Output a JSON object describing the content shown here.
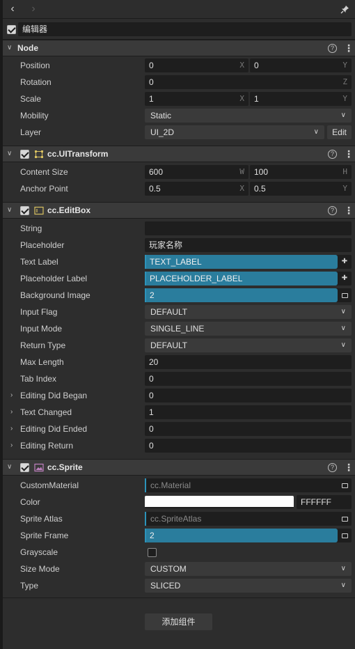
{
  "toolbar": {
    "back_icon": "chevron-left",
    "forward_icon": "chevron-right",
    "pin_icon": "pin"
  },
  "node_name": "编辑器",
  "sections": {
    "node": {
      "title": "Node",
      "position": {
        "label": "Position",
        "x": "0",
        "y": "0"
      },
      "rotation": {
        "label": "Rotation",
        "z": "0"
      },
      "scale": {
        "label": "Scale",
        "x": "1",
        "y": "1"
      },
      "mobility": {
        "label": "Mobility",
        "value": "Static"
      },
      "layer": {
        "label": "Layer",
        "value": "UI_2D",
        "edit": "Edit"
      }
    },
    "uitransform": {
      "title": "cc.UITransform",
      "content_size": {
        "label": "Content Size",
        "w": "600",
        "h": "100"
      },
      "anchor_point": {
        "label": "Anchor Point",
        "x": "0.5",
        "y": "0.5"
      }
    },
    "editbox": {
      "title": "cc.EditBox",
      "string": {
        "label": "String",
        "value": ""
      },
      "placeholder": {
        "label": "Placeholder",
        "value": "玩家名称"
      },
      "text_label": {
        "label": "Text Label",
        "value": "TEXT_LABEL"
      },
      "placeholder_label": {
        "label": "Placeholder Label",
        "value": "PLACEHOLDER_LABEL"
      },
      "background_image": {
        "label": "Background Image",
        "value": "2"
      },
      "input_flag": {
        "label": "Input Flag",
        "value": "DEFAULT"
      },
      "input_mode": {
        "label": "Input Mode",
        "value": "SINGLE_LINE"
      },
      "return_type": {
        "label": "Return Type",
        "value": "DEFAULT"
      },
      "max_length": {
        "label": "Max Length",
        "value": "20"
      },
      "tab_index": {
        "label": "Tab Index",
        "value": "0"
      },
      "editing_did_began": {
        "label": "Editing Did Began",
        "value": "0"
      },
      "text_changed": {
        "label": "Text Changed",
        "value": "1"
      },
      "editing_did_ended": {
        "label": "Editing Did Ended",
        "value": "0"
      },
      "editing_return": {
        "label": "Editing Return",
        "value": "0"
      }
    },
    "sprite": {
      "title": "cc.Sprite",
      "custom_material": {
        "label": "CustomMaterial",
        "value": "cc.Material"
      },
      "color": {
        "label": "Color",
        "hex": "FFFFFF",
        "swatch": "#ffffff"
      },
      "sprite_atlas": {
        "label": "Sprite Atlas",
        "value": "cc.SpriteAtlas"
      },
      "sprite_frame": {
        "label": "Sprite Frame",
        "value": "2"
      },
      "grayscale": {
        "label": "Grayscale",
        "checked": false
      },
      "size_mode": {
        "label": "Size Mode",
        "value": "CUSTOM"
      },
      "type": {
        "label": "Type",
        "value": "SLICED"
      }
    }
  },
  "add_component": "添加组件",
  "axes": {
    "x": "X",
    "y": "Y",
    "z": "Z",
    "w": "W",
    "h": "H"
  },
  "help_glyph": "?",
  "colors": {
    "accent": "#2a7d9d",
    "panel": "#2d2d2d",
    "header": "#3a3a3a",
    "field": "#1e1e1e"
  }
}
